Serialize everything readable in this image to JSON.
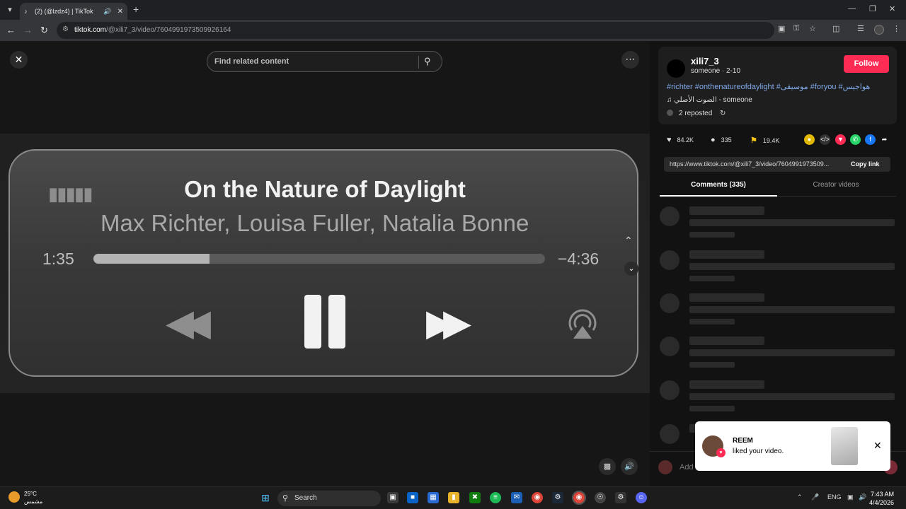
{
  "browser": {
    "tab_title": "(2) (@lzdz4) | TikTok",
    "url_host": "tiktok.com",
    "url_path": "/@xili7_3/video/7604991973509926164"
  },
  "video": {
    "search_placeholder": "Find related content",
    "song_title": "On the Nature of Daylight",
    "artists": "Max Richter, Louisa Fuller, Natalia Bonne",
    "elapsed": "1:35",
    "remaining": "−4:36",
    "progress_fraction": 0.257
  },
  "post": {
    "username": "xili7_3",
    "meta": "someone · 2-10",
    "follow_label": "Follow",
    "hashtags": "#richter #onthenatureofdaylight #موسيقى #foryou #هواجيس",
    "sound": "الصوت الأصلي - someone",
    "reposted": "2 reposted",
    "likes": "84.2K",
    "comments": "335",
    "saves": "19.4K",
    "link": "https://www.tiktok.com/@xili7_3/video/7604991973509...",
    "copy_label": "Copy link",
    "tab_comments": "Comments (335)",
    "tab_creator": "Creator videos",
    "comment_placeholder": "Add"
  },
  "toast": {
    "name": "REEM",
    "message": "liked your video."
  },
  "taskbar": {
    "temperature": "25°C",
    "weather_desc": "مشمس",
    "search_label": "Search",
    "lang": "ENG",
    "time": "7:43 AM",
    "date": "4/4/2026"
  },
  "colors": {
    "accent": "#fe2c55",
    "hashtag": "#7fa8e8"
  }
}
